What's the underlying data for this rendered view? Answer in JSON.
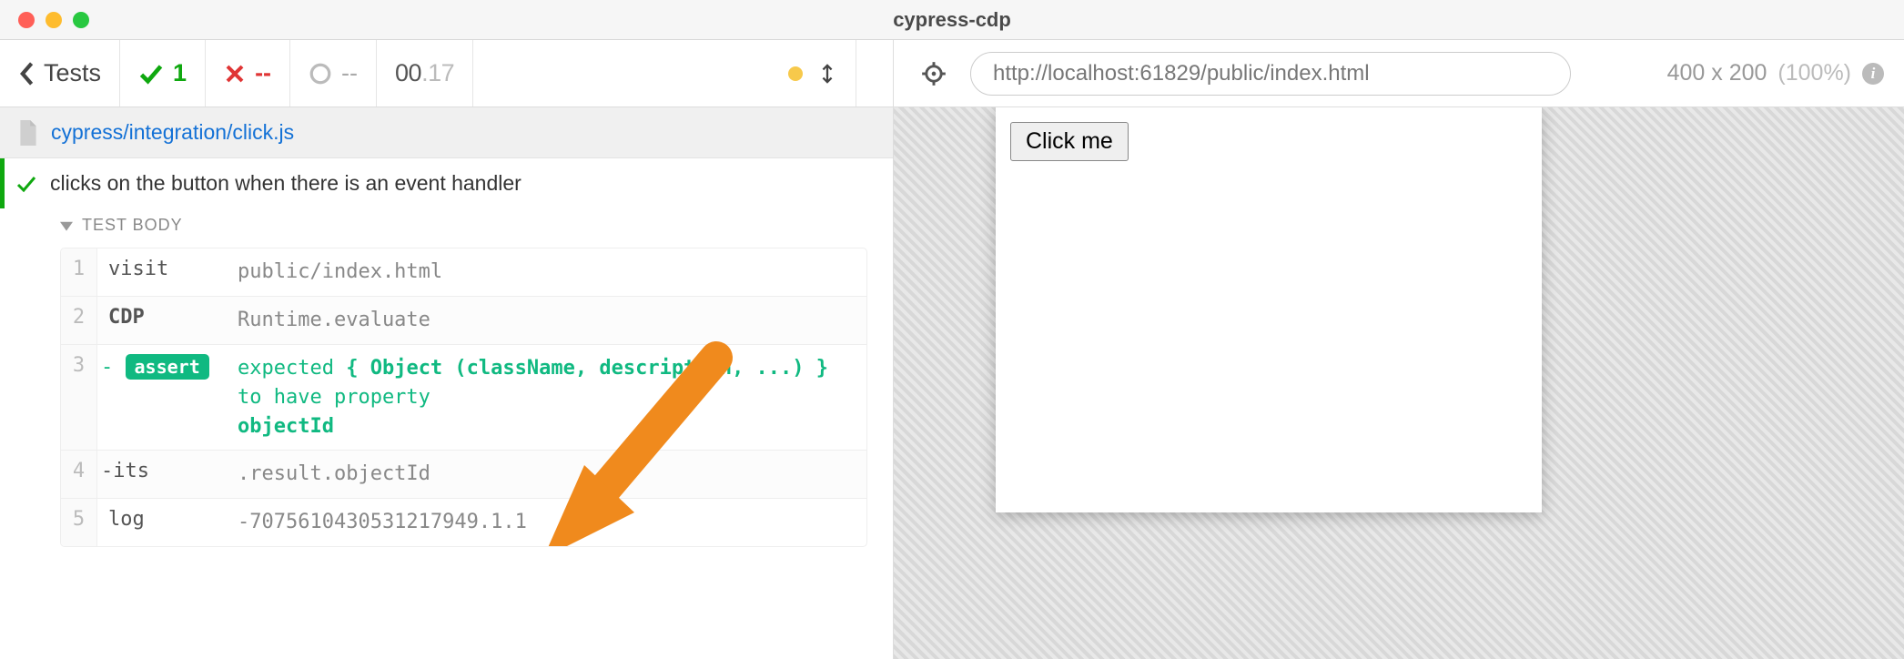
{
  "window": {
    "title": "cypress-cdp"
  },
  "toolbar": {
    "back_label": "Tests",
    "passed": "1",
    "failed": "--",
    "pending": "--",
    "duration_main": "00",
    "duration_frac": ".17"
  },
  "spec": {
    "path": "cypress/integration/click.js"
  },
  "test": {
    "title": "clicks on the button when there is an event handler",
    "body_label": "TEST BODY"
  },
  "commands": [
    {
      "num": "1",
      "name": "visit",
      "msg": "public/index.html"
    },
    {
      "num": "2",
      "name": "CDP",
      "msg": "Runtime.evaluate"
    },
    {
      "num": "3",
      "name_prefix": "-",
      "badge": "assert",
      "msg_pre": "expected ",
      "msg_obj": "{ Object (className, description, ...) }",
      "msg_mid": " to have property",
      "msg_prop": "objectId"
    },
    {
      "num": "4",
      "name": "-its",
      "msg": ".result.objectId"
    },
    {
      "num": "5",
      "name": "log",
      "msg": "-7075610430531217949.1.1"
    }
  ],
  "aut": {
    "url": "http://localhost:61829/public/index.html",
    "viewport_w": "400",
    "viewport_h": "200",
    "zoom": "(100%)",
    "button_label": "Click me"
  }
}
